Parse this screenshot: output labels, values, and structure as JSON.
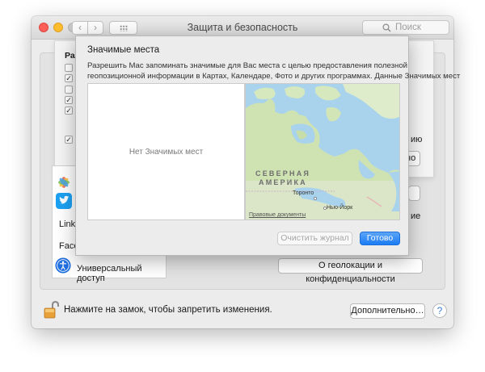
{
  "window": {
    "title": "Защита и безопасность",
    "search_placeholder": "Поиск"
  },
  "background_sheet": {
    "header_fragment": "Раз",
    "checkbox_marks": [
      "",
      "✓",
      "",
      "✓",
      "✓",
      "✓"
    ]
  },
  "apps": [
    {
      "name": "Linke"
    },
    {
      "name": "Faceb"
    },
    {
      "name": "Универсальный доступ"
    }
  ],
  "right_fragments": {
    "frag1": "ию",
    "frag2": "но",
    "frag3": "ие"
  },
  "geo_button": "О геолокации и конфиденциальности",
  "footer": {
    "lock_text": "Нажмите на замок, чтобы запретить изменения.",
    "advanced_button": "Дополнительно…",
    "help": "?"
  },
  "sheet": {
    "title": "Значимые места",
    "description_line1": "Разрешить Mac запоминать значимые для Вас места с целью предоставления полезной",
    "description_line2": "геопозиционной информации в Картах, Календаре, Фото и других программах. Данные Значимых мест",
    "empty_text": "Нет Значимых мест",
    "map": {
      "region_line1": "СЕВЕРНАЯ",
      "region_line2": "АМЕРИКА",
      "city_toronto": "Торонто",
      "city_newyork": "Нью-Йорк",
      "legal": "Правовые документы"
    },
    "clear_button": "Очистить журнал",
    "done_button": "Готово"
  }
}
